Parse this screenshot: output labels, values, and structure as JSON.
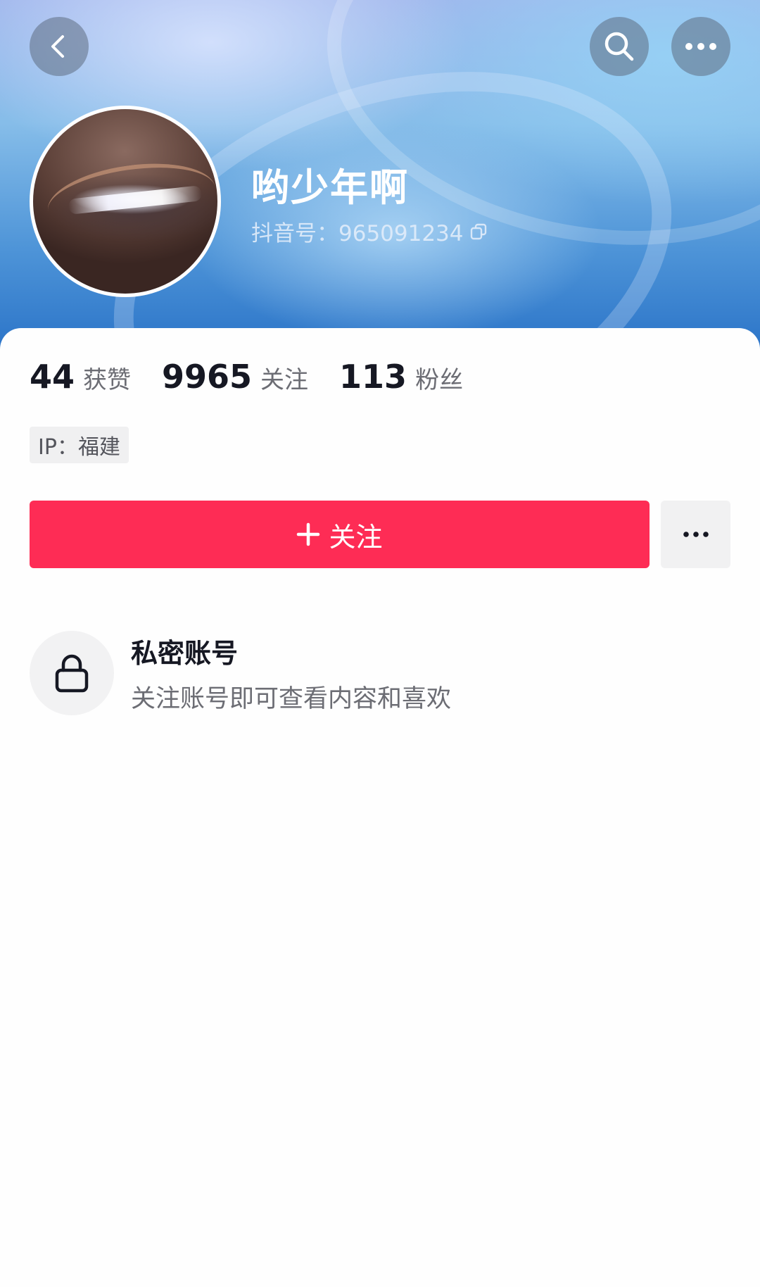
{
  "header": {
    "icons": {
      "back": "chevron-left-icon",
      "search": "search-icon",
      "more": "more-horizontal-icon"
    }
  },
  "profile": {
    "name": "哟少年啊",
    "douyin_id": "抖音号：965091234",
    "copy_icon": "copy-icon"
  },
  "stats": [
    {
      "value": "44",
      "label": "获赞"
    },
    {
      "value": "9965",
      "label": "关注"
    },
    {
      "value": "113",
      "label": "粉丝"
    }
  ],
  "ip_tag": "IP：福建",
  "actions": {
    "follow_label": "关注",
    "follow_icon": "plus-icon",
    "more_icon": "more-horizontal-icon"
  },
  "private_account": {
    "title": "私密账号",
    "description": "关注账号即可查看内容和喜欢",
    "icon": "lock-icon"
  },
  "colors": {
    "accent": "#fe2c55",
    "text_primary": "#161823",
    "text_secondary": "#6c6d74"
  }
}
